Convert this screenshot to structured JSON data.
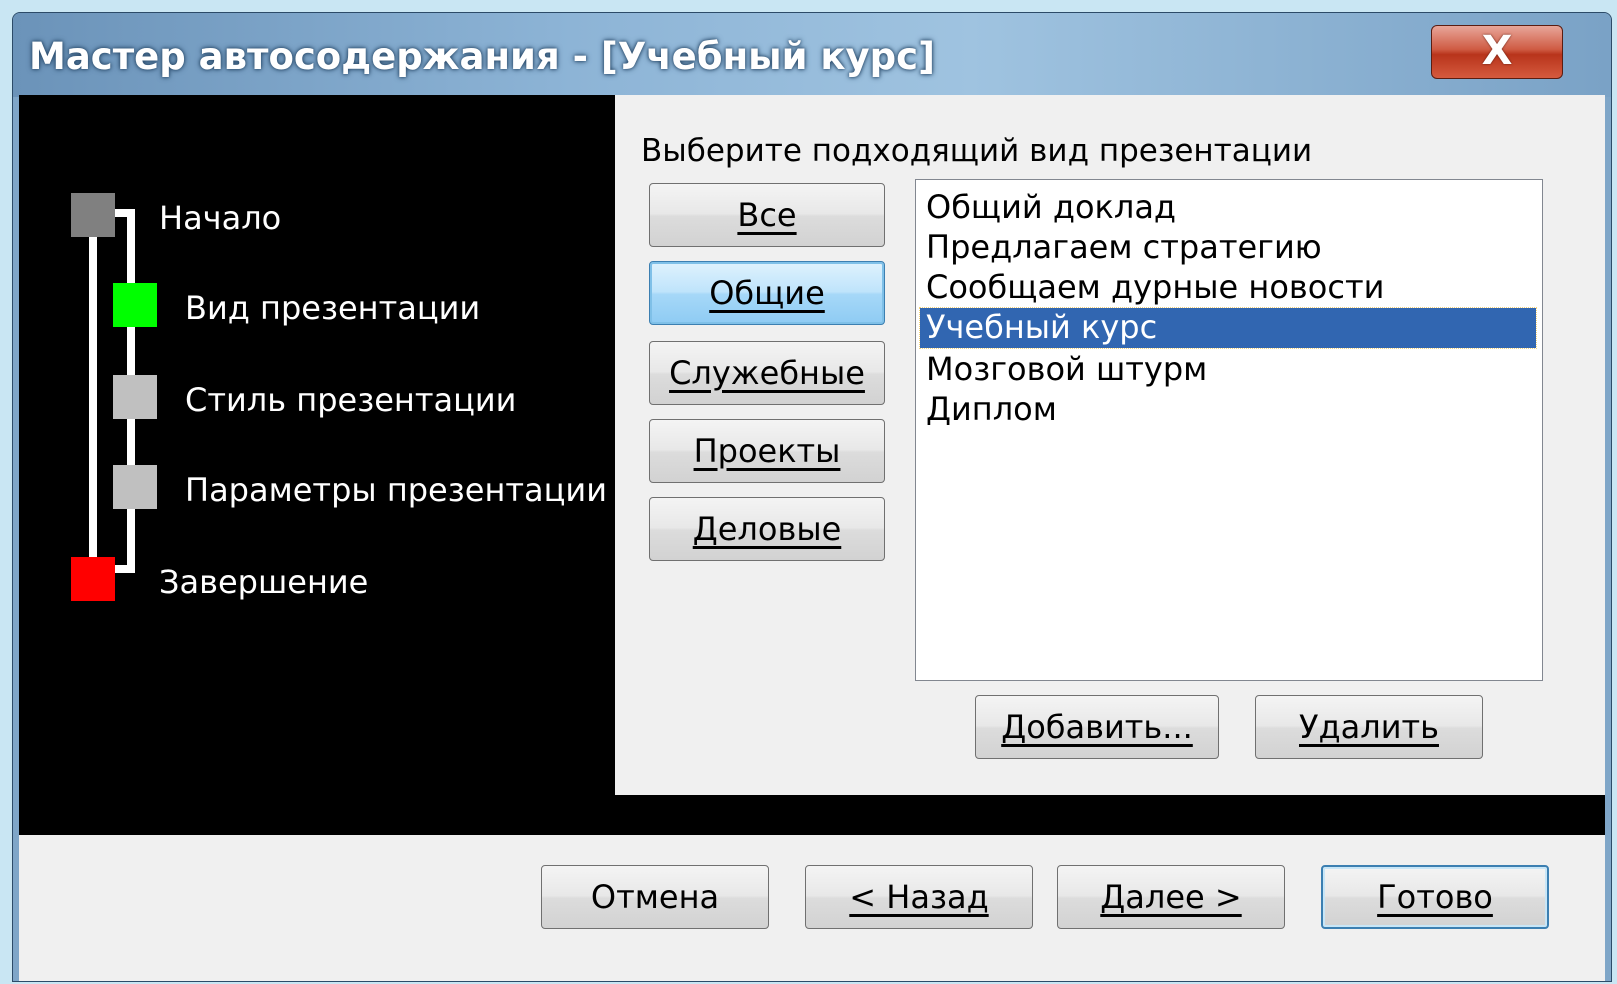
{
  "window": {
    "title": "Мастер автосодержания - [Учебный курс]",
    "close_label": "X"
  },
  "steps": {
    "items": [
      {
        "label": "Начало",
        "color": "#808080"
      },
      {
        "label": "Вид презентации",
        "color": "#00ff00"
      },
      {
        "label": "Стиль презентации",
        "color": "#c0c0c0"
      },
      {
        "label": "Параметры презентации",
        "color": "#c0c0c0"
      },
      {
        "label": "Завершение",
        "color": "#ff0000"
      }
    ]
  },
  "main": {
    "prompt": "Выберите подходящий вид презентации",
    "categories": [
      {
        "label": "Все",
        "active": false
      },
      {
        "label": "Общие",
        "active": true
      },
      {
        "label": "Служебные",
        "active": false
      },
      {
        "label": "Проекты",
        "active": false
      },
      {
        "label": "Деловые",
        "active": false
      }
    ],
    "presentations": [
      {
        "label": "Общий доклад",
        "selected": false
      },
      {
        "label": "Предлагаем стратегию",
        "selected": false
      },
      {
        "label": "Сообщаем дурные новости",
        "selected": false
      },
      {
        "label": "Учебный курс",
        "selected": true
      },
      {
        "label": "Мозговой штурм",
        "selected": false
      },
      {
        "label": "Диплом",
        "selected": false
      }
    ],
    "add_label": "Добавить...",
    "delete_label": "Удалить"
  },
  "footer": {
    "cancel_label": "Отмена",
    "back_label": "< Назад",
    "next_label": "Далее >",
    "finish_label": "Готово"
  },
  "colors": {
    "selection": "#3166b1",
    "accent": "#3c7fb1"
  }
}
